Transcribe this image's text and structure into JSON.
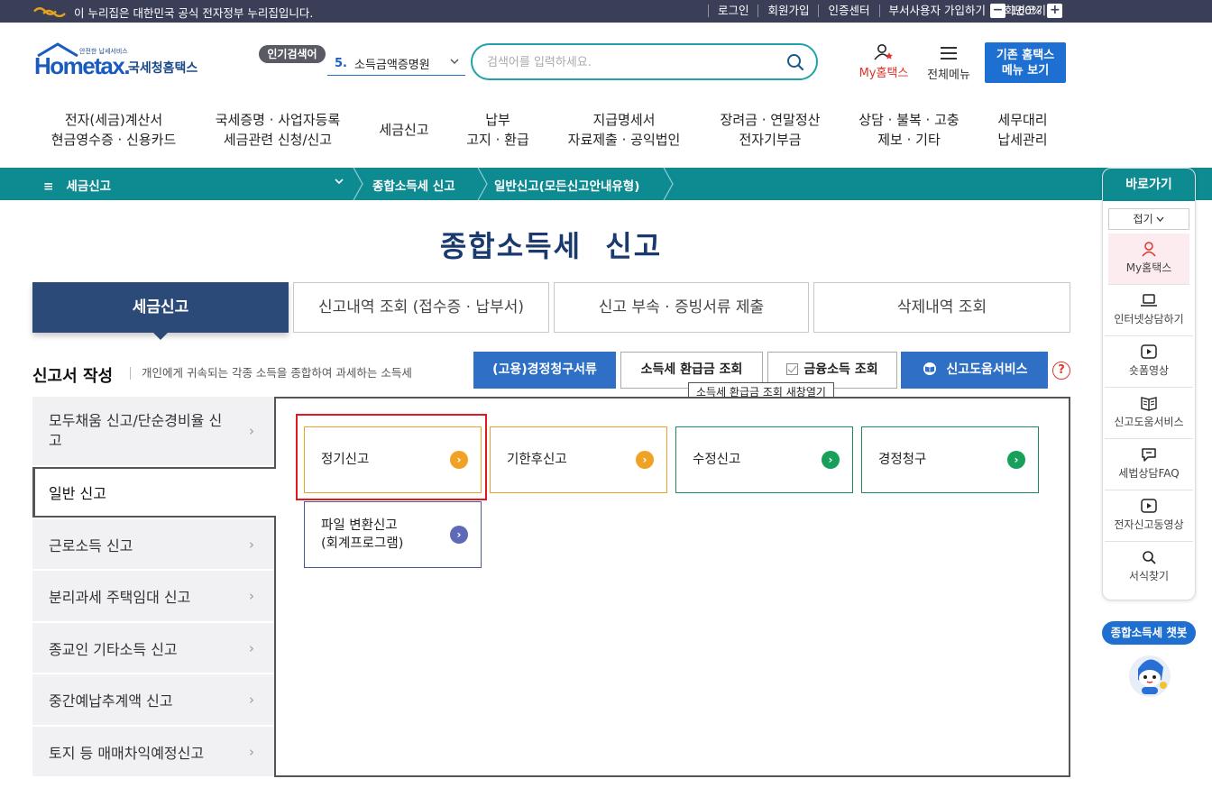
{
  "gov_banner": {
    "text": "이 누리집은 대한민국 공식 전자정부 누리집입니다.",
    "links": [
      "로그인",
      "회원가입",
      "인증센터",
      "부서사용자 가입하기",
      "화면크기"
    ],
    "zoom_minus": "−",
    "zoom_value": "100%",
    "zoom_plus": "+"
  },
  "header": {
    "logo_small": "안전한 납세서비스",
    "logo_main": "Hometax.",
    "logo_kr": "국세청홈택스",
    "popular_label": "인기검색어",
    "popular_rank": "5.",
    "popular_term": "소득금액증명원",
    "search_placeholder": "검색어를 입력하세요.",
    "my_hometax": "My홈택스",
    "all_menu": "전체메뉴",
    "old_menu_line1": "기존 홈택스",
    "old_menu_line2": "메뉴 보기"
  },
  "gnb": [
    {
      "line1": "전자(세금)계산서",
      "line2": "현금영수증 · 신용카드"
    },
    {
      "line1": "국세증명 · 사업자등록",
      "line2": "세금관련 신청/신고"
    },
    {
      "line1": "세금신고",
      "line2": ""
    },
    {
      "line1": "납부",
      "line2": "고지 · 환급"
    },
    {
      "line1": "지급명세서",
      "line2": "자료제출 · 공익법인"
    },
    {
      "line1": "장려금 · 연말정산",
      "line2": "전자기부금"
    },
    {
      "line1": "상담 · 불복 · 고충",
      "line2": "제보 · 기타"
    },
    {
      "line1": "세무대리",
      "line2": "납세관리"
    }
  ],
  "breadcrumb": {
    "menu_icon": "≡",
    "level1": "세금신고",
    "level2": "종합소득세 신고",
    "level3": "일반신고(모든신고안내유형)"
  },
  "page_title": "종합소득세  신고",
  "tabs": [
    "세금신고",
    "신고내역 조회 (접수증 · 납부서)",
    "신고 부속 · 증빙서류 제출",
    "삭제내역 조회"
  ],
  "section": {
    "title": "신고서 작성",
    "description": "개인에게 귀속되는 각종 소득을 종합하여 과세하는 소득세",
    "buttons": [
      "(고용)경정청구서류",
      "소득세 환급금 조회",
      "금융소득 조회",
      "신고도움서비스"
    ],
    "help": "?",
    "tooltip": "소득세 환급금 조회 새창열기"
  },
  "side_menu": [
    {
      "label": "모두채움 신고/단순경비율 신고"
    },
    {
      "label": "일반 신고"
    },
    {
      "label": "근로소득 신고"
    },
    {
      "label": "분리과세 주택임대 신고"
    },
    {
      "label": "종교인 기타소득 신고"
    },
    {
      "label": "중간예납추계액 신고"
    },
    {
      "label": "토지 등 매매차익예정신고"
    }
  ],
  "cards": [
    {
      "line1": "정기신고",
      "line2": ""
    },
    {
      "line1": "기한후신고",
      "line2": ""
    },
    {
      "line1": "수정신고",
      "line2": ""
    },
    {
      "line1": "경정청구",
      "line2": ""
    },
    {
      "line1": "파일 변환신고",
      "line2": "(회계프로그램)"
    }
  ],
  "quick_links": {
    "title": "바로가기",
    "fold": "접기",
    "items": [
      "My홈택스",
      "인터넷상담하기",
      "숏폼영상",
      "신고도움서비스",
      "세법상담FAQ",
      "전자신고동영상",
      "서식찾기"
    ]
  },
  "chatbot": {
    "label": "종합소득세 챗봇"
  },
  "colors": {
    "teal": "#0e8a91",
    "navy_tab": "#2c4a78",
    "blue_button": "#2f6fc6",
    "highlight_red": "#e0191e",
    "orange": "#f0a224",
    "green": "#16a05a",
    "purple": "#5e6ab8"
  }
}
